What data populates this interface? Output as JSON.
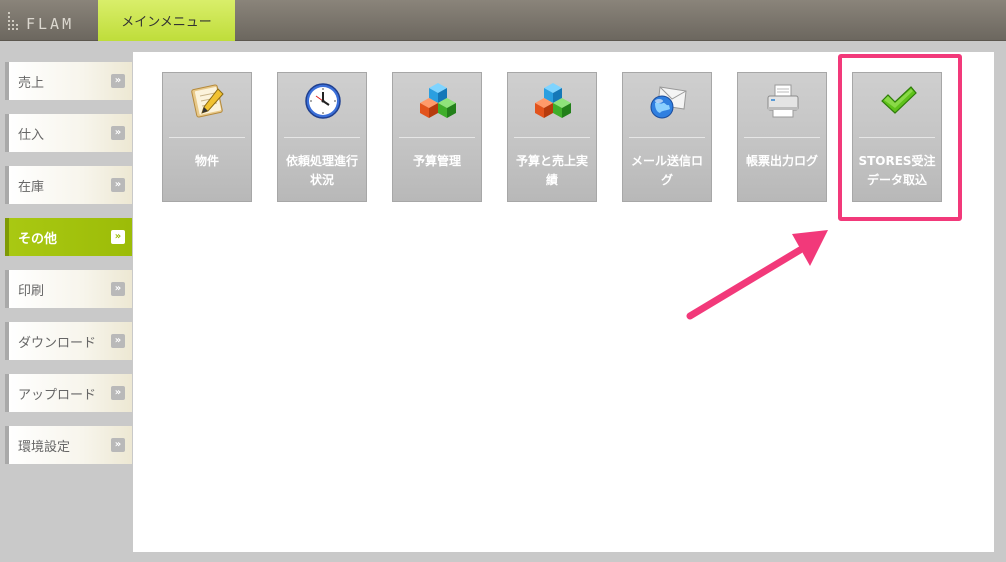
{
  "header": {
    "logo_text": "FLAM",
    "main_tab_label": "メインメニュー"
  },
  "sidebar": {
    "items": [
      {
        "label": "売上",
        "active": false
      },
      {
        "label": "仕入",
        "active": false
      },
      {
        "label": "在庫",
        "active": false
      },
      {
        "label": "その他",
        "active": true
      },
      {
        "label": "印刷",
        "active": false
      },
      {
        "label": "ダウンロード",
        "active": false
      },
      {
        "label": "アップロード",
        "active": false
      },
      {
        "label": "環境設定",
        "active": false
      }
    ],
    "arrow_glyph": "»"
  },
  "tiles": [
    {
      "label": "物件",
      "icon": "notebook-pencil-icon"
    },
    {
      "label": "依頼処理進行状況",
      "icon": "clock-icon"
    },
    {
      "label": "予算管理",
      "icon": "cubes-icon"
    },
    {
      "label": "予算と売上実績",
      "icon": "cubes-icon"
    },
    {
      "label": "メール送信ログ",
      "icon": "mail-globe-icon"
    },
    {
      "label": "帳票出力ログ",
      "icon": "printer-icon"
    },
    {
      "label": "STORES受注データ取込",
      "icon": "checkmark-icon"
    }
  ],
  "colors": {
    "accent_green": "#9cbc08",
    "tab_green": "#c9e24c",
    "highlight_pink": "#f2397a"
  }
}
